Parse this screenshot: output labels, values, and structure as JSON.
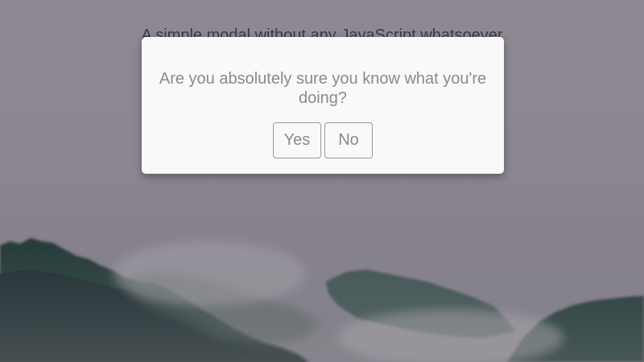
{
  "page": {
    "heading": "A simple modal without any JavaScript whatsoever"
  },
  "modal": {
    "question": "Are you absolutely sure you know what you're doing?",
    "yes_label": "Yes",
    "no_label": "No"
  },
  "colors": {
    "overlay": "#8d8892",
    "modal_background": "#f9f9f9",
    "text": "#8a8a8a",
    "forest_dark": "#1f3530",
    "forest_mid": "#2d4a44"
  },
  "icons": []
}
